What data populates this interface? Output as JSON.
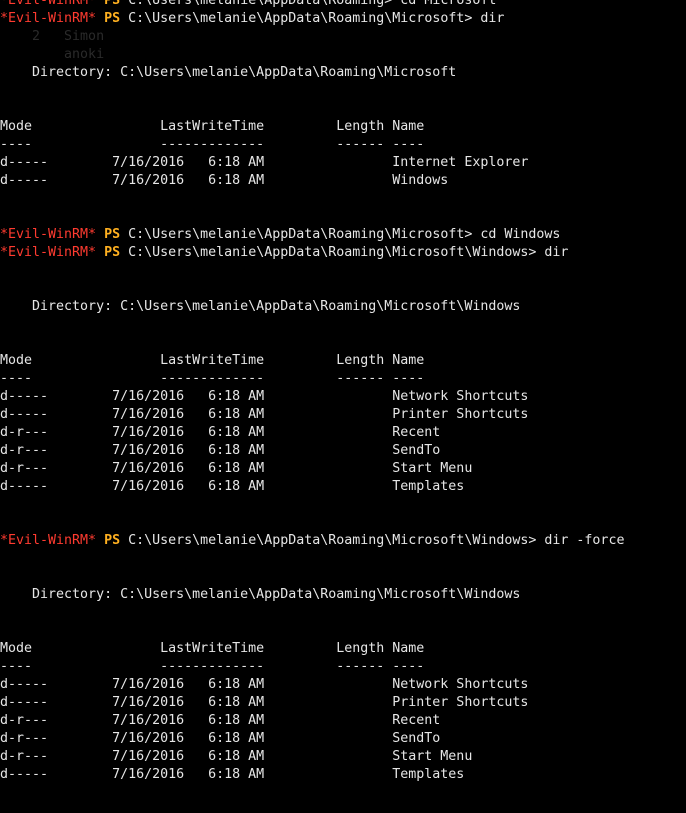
{
  "prompt": {
    "label": "*Evil-WinRM*",
    "ps": "PS"
  },
  "lines": [
    {
      "type": "prompt",
      "cmd": " C:\\Users\\melanie\\AppData\\Roaming> cd Microsoft"
    },
    {
      "type": "prompt",
      "cmd": " C:\\Users\\melanie\\AppData\\Roaming\\Microsoft> dir"
    },
    {
      "type": "faint",
      "text": "    2   Simon"
    },
    {
      "type": "faint",
      "text": "        anoki"
    },
    {
      "type": "text",
      "text": "    Directory: C:\\Users\\melanie\\AppData\\Roaming\\Microsoft"
    },
    {
      "type": "blank"
    },
    {
      "type": "blank"
    },
    {
      "type": "text",
      "text": "Mode                LastWriteTime         Length Name"
    },
    {
      "type": "text",
      "text": "----                -------------         ------ ----"
    },
    {
      "type": "text",
      "text": "d-----        7/16/2016   6:18 AM                Internet Explorer"
    },
    {
      "type": "text",
      "text": "d-----        7/16/2016   6:18 AM                Windows"
    },
    {
      "type": "blank"
    },
    {
      "type": "blank"
    },
    {
      "type": "prompt",
      "cmd": " C:\\Users\\melanie\\AppData\\Roaming\\Microsoft> cd Windows"
    },
    {
      "type": "prompt",
      "cmd": " C:\\Users\\melanie\\AppData\\Roaming\\Microsoft\\Windows> dir"
    },
    {
      "type": "blank"
    },
    {
      "type": "blank"
    },
    {
      "type": "text",
      "text": "    Directory: C:\\Users\\melanie\\AppData\\Roaming\\Microsoft\\Windows"
    },
    {
      "type": "blank"
    },
    {
      "type": "blank"
    },
    {
      "type": "text",
      "text": "Mode                LastWriteTime         Length Name"
    },
    {
      "type": "text",
      "text": "----                -------------         ------ ----"
    },
    {
      "type": "text",
      "text": "d-----        7/16/2016   6:18 AM                Network Shortcuts"
    },
    {
      "type": "text",
      "text": "d-----        7/16/2016   6:18 AM                Printer Shortcuts"
    },
    {
      "type": "text",
      "text": "d-r---        7/16/2016   6:18 AM                Recent"
    },
    {
      "type": "text",
      "text": "d-r---        7/16/2016   6:18 AM                SendTo"
    },
    {
      "type": "text",
      "text": "d-r---        7/16/2016   6:18 AM                Start Menu"
    },
    {
      "type": "text",
      "text": "d-----        7/16/2016   6:18 AM                Templates"
    },
    {
      "type": "blank"
    },
    {
      "type": "blank"
    },
    {
      "type": "prompt",
      "cmd": " C:\\Users\\melanie\\AppData\\Roaming\\Microsoft\\Windows> dir -force"
    },
    {
      "type": "blank"
    },
    {
      "type": "blank"
    },
    {
      "type": "text",
      "text": "    Directory: C:\\Users\\melanie\\AppData\\Roaming\\Microsoft\\Windows"
    },
    {
      "type": "blank"
    },
    {
      "type": "blank"
    },
    {
      "type": "text",
      "text": "Mode                LastWriteTime         Length Name"
    },
    {
      "type": "text",
      "text": "----                -------------         ------ ----"
    },
    {
      "type": "text",
      "text": "d-----        7/16/2016   6:18 AM                Network Shortcuts"
    },
    {
      "type": "text",
      "text": "d-----        7/16/2016   6:18 AM                Printer Shortcuts"
    },
    {
      "type": "text",
      "text": "d-r---        7/16/2016   6:18 AM                Recent"
    },
    {
      "type": "text",
      "text": "d-r---        7/16/2016   6:18 AM                SendTo"
    },
    {
      "type": "text",
      "text": "d-r---        7/16/2016   6:18 AM                Start Menu"
    },
    {
      "type": "text",
      "text": "d-----        7/16/2016   6:18 AM                Templates"
    },
    {
      "type": "blank"
    }
  ],
  "colors": {
    "background": "#000000",
    "foreground": "#e6e6e6",
    "prompt_label": "#ff3b30",
    "ps_keyword": "#ffb020"
  }
}
